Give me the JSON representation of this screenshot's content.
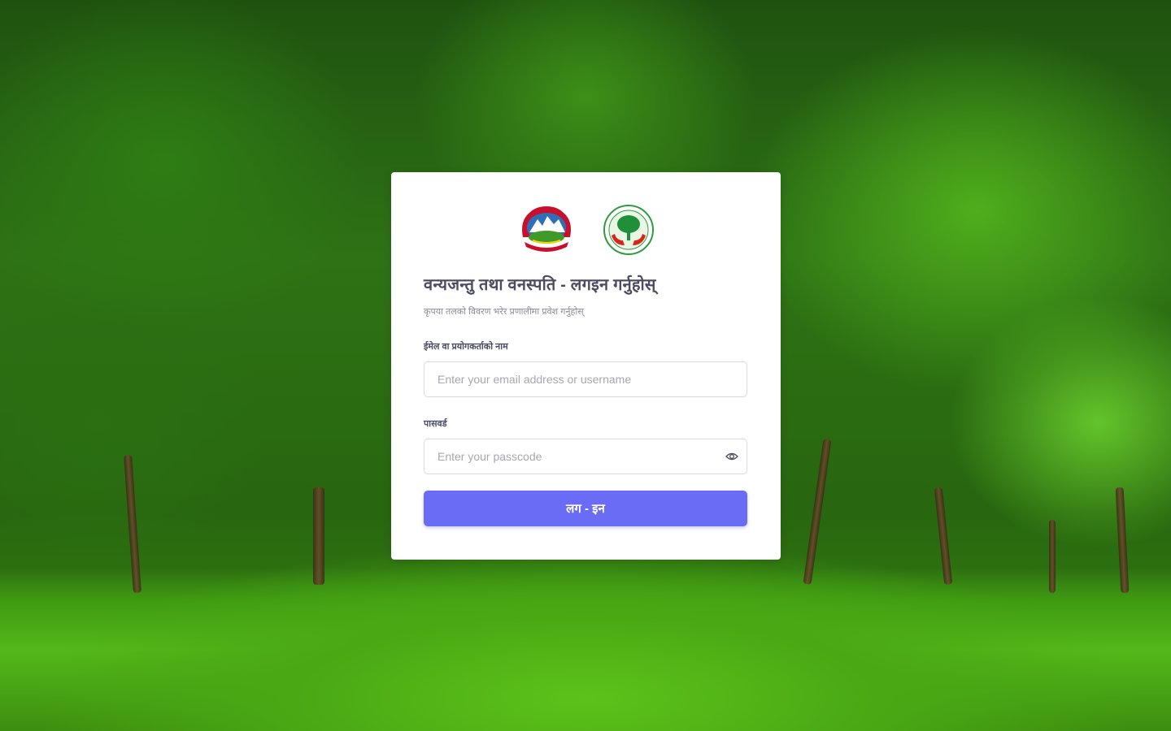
{
  "login": {
    "title": "वन्यजन्तु तथा वनस्पति - लगइन गर्नुहोस्",
    "subtitle": "कृपया तलको विवरण भरेर प्रणालीमा प्रवेश गर्नुहोस्",
    "username_label": "ईमेल वा प्रयोगकर्ताको नाम",
    "username_placeholder": "Enter your email address or username",
    "password_label": "पासवर्ड",
    "password_placeholder": "Enter your passcode",
    "submit_label": "लग - इन"
  },
  "icons": {
    "emblem": "nepal-emblem-logo",
    "forest": "forest-department-logo",
    "password_toggle": "eye-icon"
  },
  "colors": {
    "primary": "#6a6cf6",
    "title": "#4b4b63"
  }
}
